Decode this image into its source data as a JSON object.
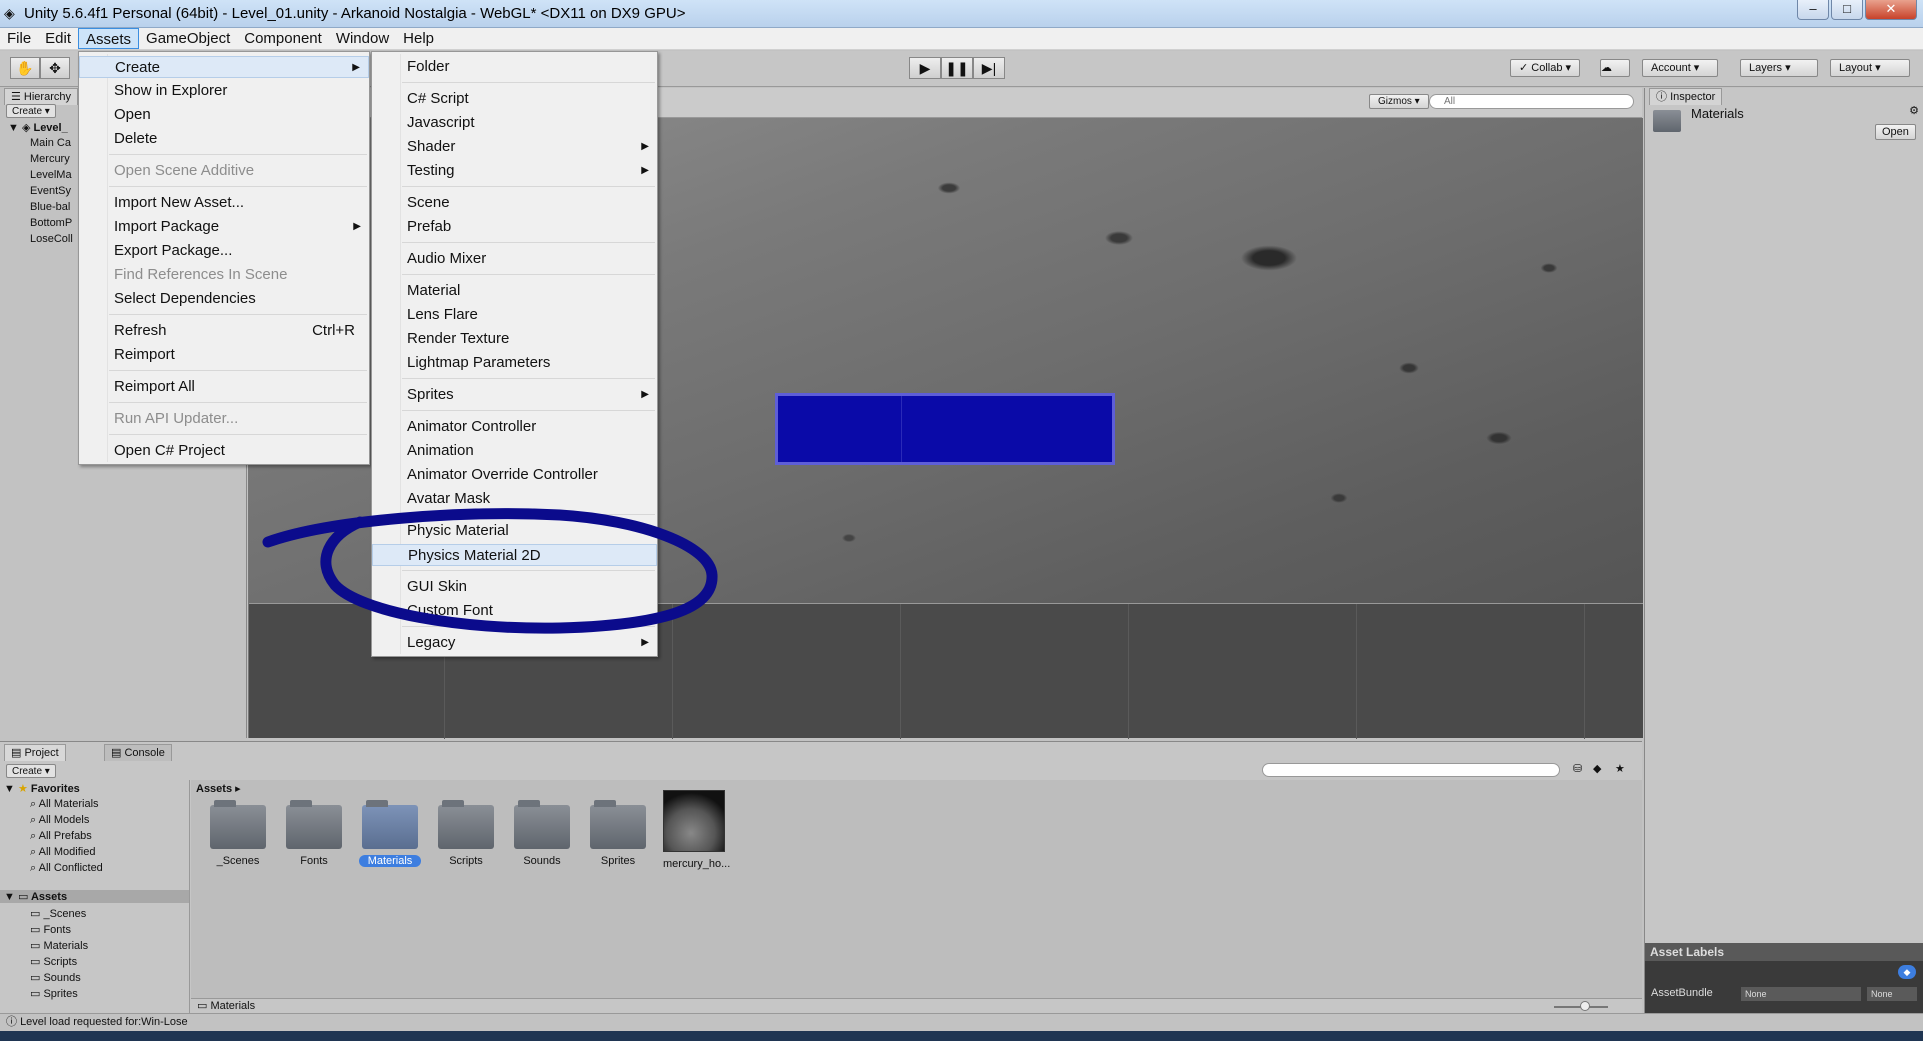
{
  "window": {
    "title": "Unity 5.6.4f1 Personal (64bit) - Level_01.unity - Arkanoid Nostalgia - WebGL* <DX11 on DX9 GPU>",
    "min": "–",
    "max": "□",
    "close": "✕"
  },
  "menubar": [
    "File",
    "Edit",
    "Assets",
    "GameObject",
    "Component",
    "Window",
    "Help"
  ],
  "toolbar": {
    "collab": "Collab",
    "account": "Account",
    "layers": "Layers",
    "layout": "Layout"
  },
  "hierarchy": {
    "tab": "Hierarchy",
    "create": "Create",
    "scene": "Level_",
    "items": [
      "Main Ca",
      "Mercury",
      "LevelMa",
      "EventSy",
      "Blue-bal",
      "BottomP",
      "LoseColl"
    ]
  },
  "scene_view": {
    "gizmos": "Gizmos",
    "search_placeholder": "All"
  },
  "assets_menu": {
    "items": [
      {
        "label": "Create",
        "submenu": true
      },
      {
        "label": "Show in Explorer"
      },
      {
        "label": "Open"
      },
      {
        "label": "Delete"
      },
      {
        "label": "Open Scene Additive",
        "disabled": true
      },
      {
        "label": "Import New Asset..."
      },
      {
        "label": "Import Package",
        "submenu": true
      },
      {
        "label": "Export Package..."
      },
      {
        "label": "Find References In Scene",
        "disabled": true
      },
      {
        "label": "Select Dependencies"
      },
      {
        "label": "Refresh",
        "shortcut": "Ctrl+R"
      },
      {
        "label": "Reimport"
      },
      {
        "label": "Reimport All"
      },
      {
        "label": "Run API Updater...",
        "disabled": true
      },
      {
        "label": "Open C# Project"
      }
    ]
  },
  "create_menu": {
    "items": [
      {
        "label": "Folder"
      },
      {
        "label": "C# Script"
      },
      {
        "label": "Javascript"
      },
      {
        "label": "Shader",
        "submenu": true
      },
      {
        "label": "Testing",
        "submenu": true
      },
      {
        "label": "Scene"
      },
      {
        "label": "Prefab"
      },
      {
        "label": "Audio Mixer"
      },
      {
        "label": "Material"
      },
      {
        "label": "Lens Flare"
      },
      {
        "label": "Render Texture"
      },
      {
        "label": "Lightmap Parameters"
      },
      {
        "label": "Sprites",
        "submenu": true
      },
      {
        "label": "Animator Controller"
      },
      {
        "label": "Animation"
      },
      {
        "label": "Animator Override Controller"
      },
      {
        "label": "Avatar Mask"
      },
      {
        "label": "Physic Material"
      },
      {
        "label": "Physics Material 2D",
        "highlighted": true
      },
      {
        "label": "GUI Skin"
      },
      {
        "label": "Custom Font"
      },
      {
        "label": "Legacy",
        "submenu": true
      }
    ]
  },
  "inspector": {
    "tab": "Inspector",
    "asset_name": "Materials",
    "open_button": "Open",
    "asset_labels": "Asset Labels",
    "asset_bundle_label": "AssetBundle",
    "asset_bundle_value": "None",
    "asset_bundle_variant": "None"
  },
  "project": {
    "tab_project": "Project",
    "tab_console": "Console",
    "create": "Create",
    "favorites_header": "Favorites",
    "favorites": [
      "All Materials",
      "All Models",
      "All Prefabs",
      "All Modified",
      "All Conflicted"
    ],
    "assets_header": "Assets",
    "asset_folders": [
      "_Scenes",
      "Fonts",
      "Materials",
      "Scripts",
      "Sounds",
      "Sprites"
    ],
    "breadcrumb": "Assets",
    "grid_items": [
      "_Scenes",
      "Fonts",
      "Materials",
      "Scripts",
      "Sounds",
      "Sprites",
      "mercury_ho..."
    ],
    "selected_item": "Materials",
    "footer_path": "Materials"
  },
  "status": {
    "message": "Level load requested for:Win-Lose"
  },
  "annotation": {
    "color": "#0b0b8c"
  }
}
